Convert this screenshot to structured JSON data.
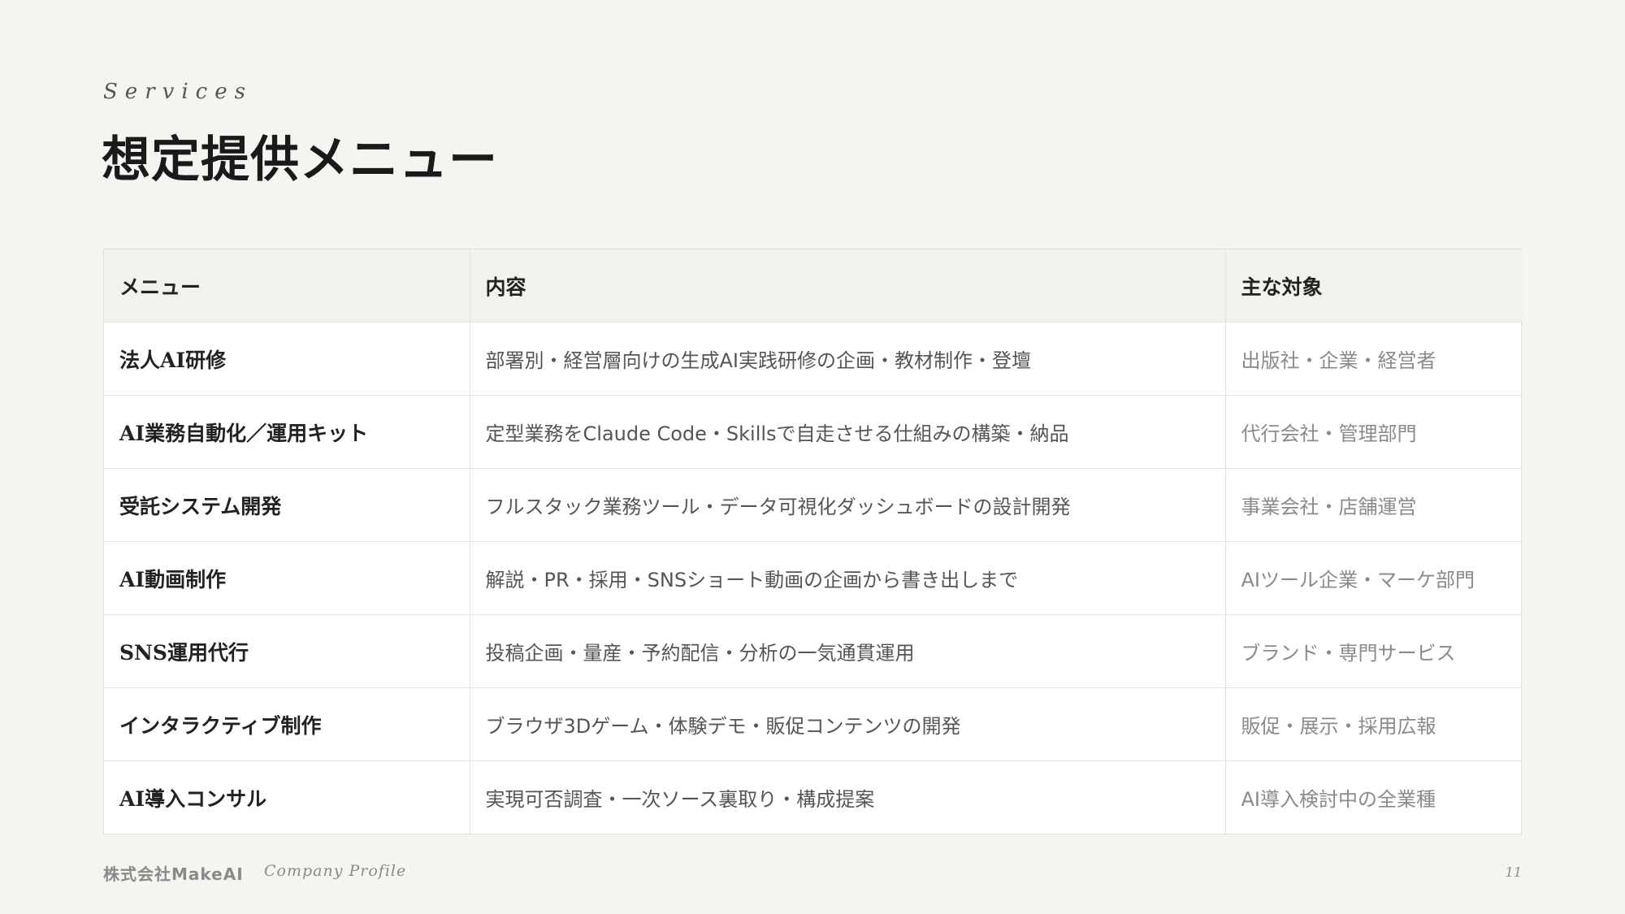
{
  "header": {
    "eyebrow": "Services",
    "title": "想定提供メニュー"
  },
  "table": {
    "columns": [
      "メニュー",
      "内容",
      "主な対象"
    ],
    "rows": [
      {
        "menu": "法人AI研修",
        "content": "部署別・経営層向けの生成AI実践研修の企画・教材制作・登壇",
        "target": "出版社・企業・経営者"
      },
      {
        "menu": "AI業務自動化／運用キット",
        "content": "定型業務をClaude Code・Skillsで自走させる仕組みの構築・納品",
        "target": "代行会社・管理部門"
      },
      {
        "menu": "受託システム開発",
        "content": "フルスタック業務ツール・データ可視化ダッシュボードの設計開発",
        "target": "事業会社・店舗運営"
      },
      {
        "menu": "AI動画制作",
        "content": "解説・PR・採用・SNSショート動画の企画から書き出しまで",
        "target": "AIツール企業・マーケ部門"
      },
      {
        "menu": "SNS運用代行",
        "content": "投稿企画・量産・予約配信・分析の一気通貫運用",
        "target": "ブランド・専門サービス"
      },
      {
        "menu": "インタラクティブ制作",
        "content": "ブラウザ3Dゲーム・体験デモ・販促コンテンツの開発",
        "target": "販促・展示・採用広報"
      },
      {
        "menu": "AI導入コンサル",
        "content": "実現可否調査・一次ソース裏取り・構成提案",
        "target": "AI導入検討中の全業種"
      }
    ]
  },
  "footer": {
    "company": "株式会社MakeAI",
    "profile": "Company Profile",
    "page_number": "11"
  }
}
